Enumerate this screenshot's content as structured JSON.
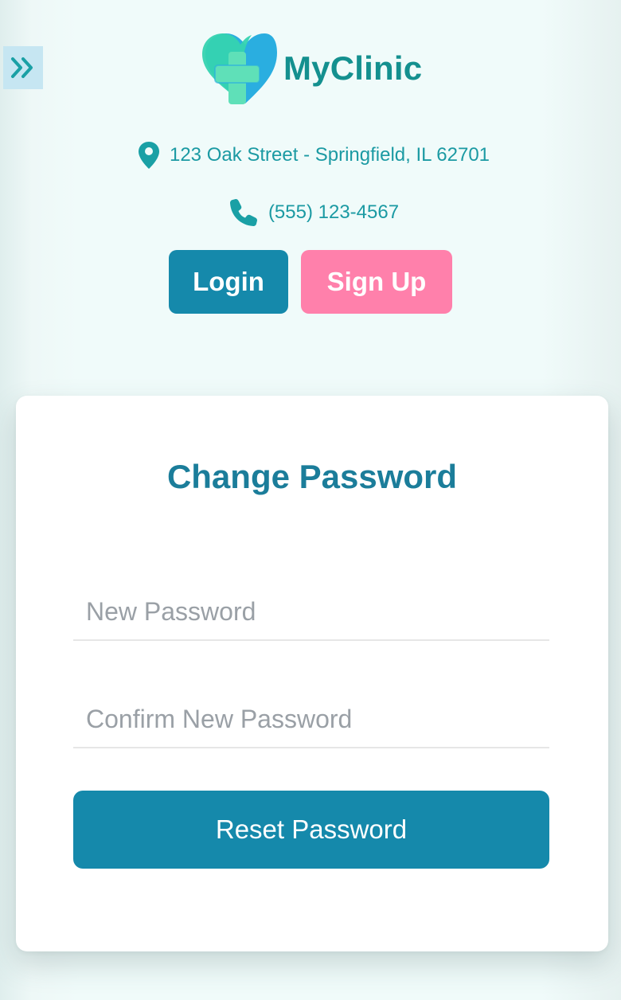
{
  "sidebar_toggle": {
    "icon": "double-chevron-right-icon"
  },
  "brand": {
    "name": "MyClinic",
    "logo_icon": "heart-cross-logo"
  },
  "contact": {
    "address": "123 Oak Street - Springfield, IL 62701",
    "phone": "(555) 123-4567",
    "address_icon": "map-pin-icon",
    "phone_icon": "phone-icon"
  },
  "auth": {
    "login_label": "Login",
    "signup_label": "Sign Up"
  },
  "form": {
    "title": "Change Password",
    "new_password": {
      "placeholder": "New Password",
      "value": ""
    },
    "confirm_password": {
      "placeholder": "Confirm New Password",
      "value": ""
    },
    "submit_label": "Reset Password"
  },
  "colors": {
    "primary": "#1589ab",
    "accent_pink": "#ff80ab",
    "brand_teal": "#14908f",
    "contact_text": "#1b9aa3",
    "background": "#f0fbfa"
  }
}
